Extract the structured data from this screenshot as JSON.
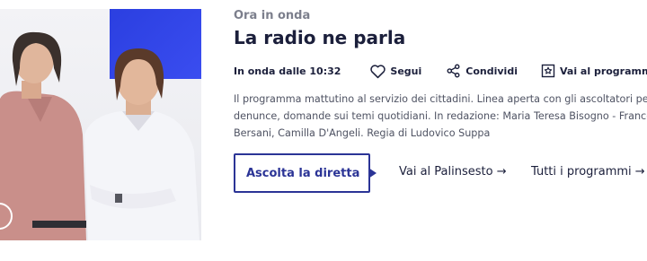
{
  "hero": {
    "accent_color": "#2b3fe0",
    "image_subject": "two presenters portrait"
  },
  "now_playing": {
    "label": "Ora in onda",
    "title": "La radio ne parla",
    "air_time": "In onda dalle 10:32",
    "follow_label": "Segui",
    "share_label": "Condividi",
    "goto_program_label": "Vai al programma",
    "description_lines": [
      "Il programma mattutino al servizio dei cittadini. Linea aperta con gli ascoltatori per se",
      "denunce, domande sui temi quotidiani. In redazione: Maria Teresa Bisogno - Francesca",
      "Bersani, Camilla D'Angeli. Regia di Ludovico Suppa"
    ]
  },
  "actions": {
    "listen_live_label": "Ascolta la diretta",
    "schedule_link_label": "Vai al Palinsesto →",
    "all_programs_link_label": "Tutti i programmi →"
  },
  "colors": {
    "primary": "#2b3496",
    "text": "#1b1f3b",
    "muted": "#7c7f8c"
  }
}
